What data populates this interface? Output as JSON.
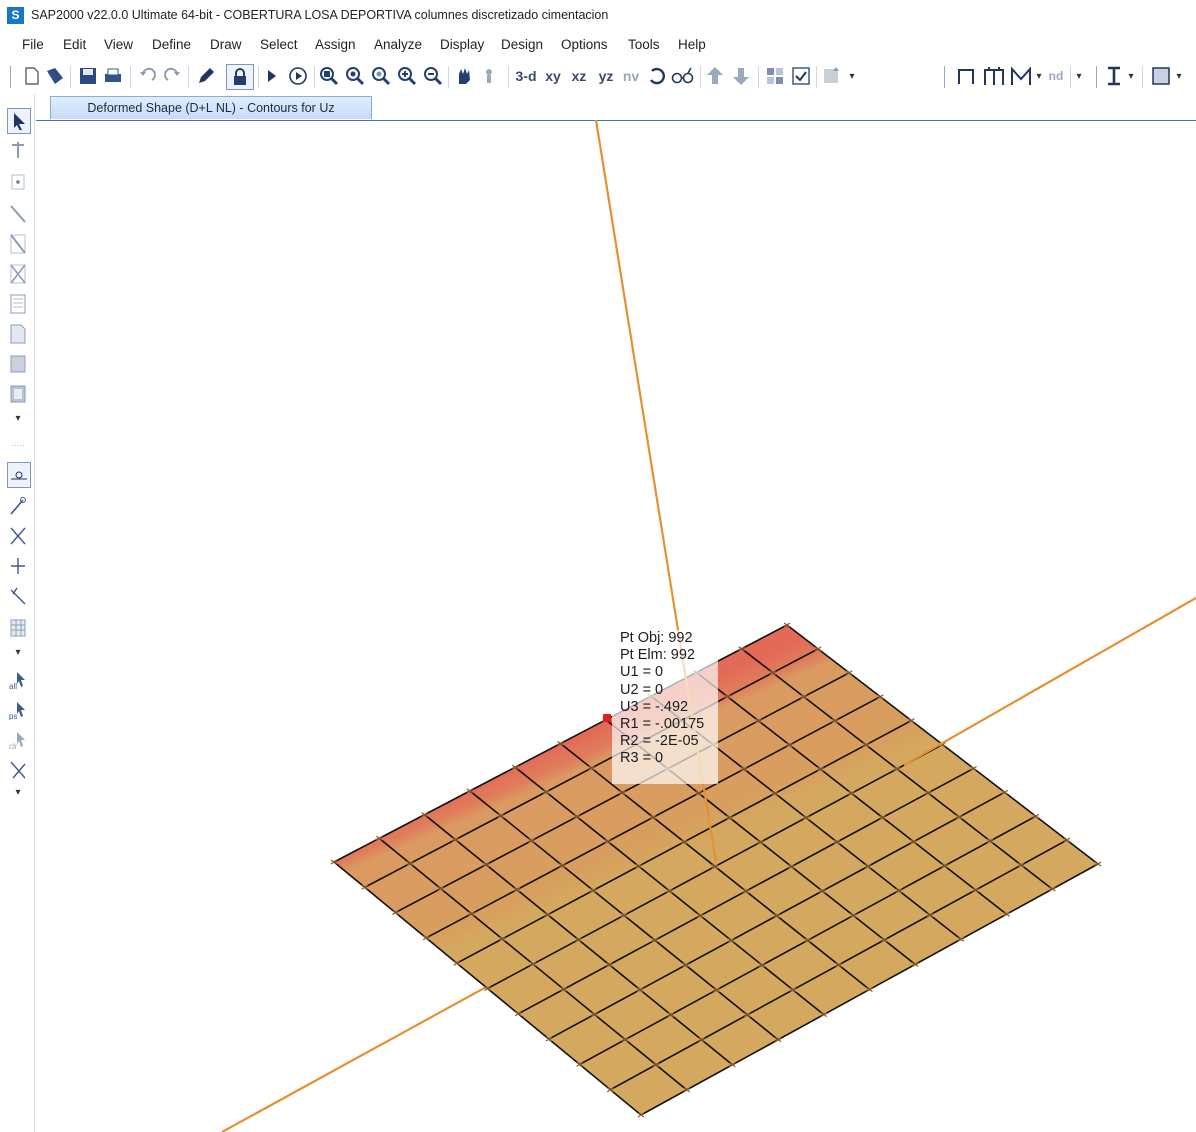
{
  "window": {
    "title": "SAP2000 v22.0.0 Ultimate 64-bit - COBERTURA LOSA DEPORTIVA columnes discretizado cimentacion",
    "app_icon_letter": "S"
  },
  "menu": [
    "File",
    "Edit",
    "View",
    "Define",
    "Draw",
    "Select",
    "Assign",
    "Analyze",
    "Display",
    "Design",
    "Options",
    "Tools",
    "Help"
  ],
  "toolbar": {
    "view_3d": "3-d",
    "view_xy": "xy",
    "view_xz": "xz",
    "view_yz": "yz",
    "view_nv": "nv",
    "nd_label": "nd"
  },
  "tab": {
    "label": "Deformed Shape (D+L NL) - Contours for Uz"
  },
  "tooltip": {
    "lines": [
      "Pt Obj: 992",
      "Pt Elm: 992",
      "U1 = 0",
      "U2 = 0",
      "U3 = -.492",
      "R1 = -.00175",
      "R2 = -2E-05",
      "R3 = 0"
    ]
  },
  "colors": {
    "grid_line": "#111111",
    "contour_red": "#e36a58",
    "contour_orange": "#db9a62",
    "contour_amber": "#d5a85f",
    "frame_member": "#e69035",
    "tab_border": "#4a72b0"
  },
  "icons": [
    "new-file-icon",
    "open-icon",
    "save-icon",
    "print-icon",
    "undo-icon",
    "redo-icon",
    "pencil-icon",
    "lock-icon",
    "run-icon",
    "run-analysis-icon",
    "zoom-window-icon",
    "zoom-in-icon",
    "zoom-out-icon",
    "zoom-fit-icon",
    "zoom-previous-icon",
    "pan-icon",
    "rotate-icon",
    "set-display-icon",
    "grid-icon",
    "select-icon",
    "reshaper-icon"
  ]
}
